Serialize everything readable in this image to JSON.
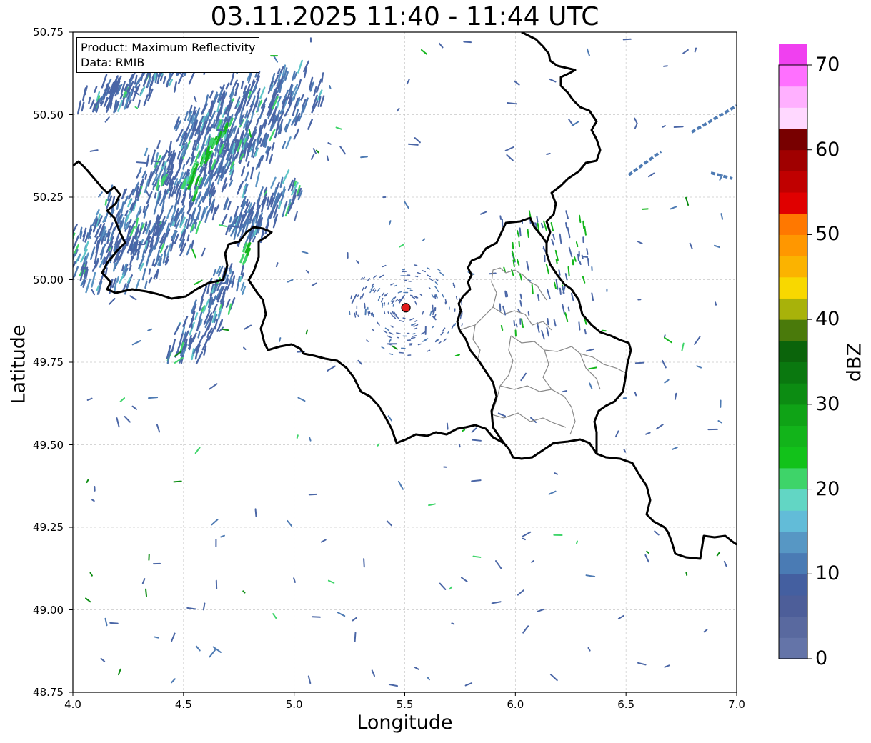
{
  "title": "03.11.2025 11:40 - 11:44 UTC",
  "info_box": {
    "product": "Product: Maximum Reflectivity",
    "data": "Data: RMIB"
  },
  "axes": {
    "xlabel": "Longitude",
    "ylabel": "Latitude",
    "xlim": [
      4.0,
      7.0
    ],
    "ylim": [
      48.75,
      50.75
    ],
    "xticks": [
      "4.0",
      "4.5",
      "5.0",
      "5.5",
      "6.0",
      "6.5",
      "7.0"
    ],
    "yticks": [
      "48.75",
      "49.00",
      "49.25",
      "49.50",
      "49.75",
      "50.00",
      "50.25",
      "50.50",
      "50.75"
    ],
    "grid": true
  },
  "radar_site": {
    "lon": 5.505,
    "lat": 49.915,
    "marker_color": "#e11d1d"
  },
  "colorbar": {
    "label": "dBZ",
    "min": 0,
    "max": 70,
    "step": 2.5,
    "ticks": [
      "0",
      "10",
      "20",
      "30",
      "40",
      "50",
      "60",
      "70"
    ],
    "colors": [
      "#6474a8",
      "#59699f",
      "#4d5e99",
      "#445fa0",
      "#4a7bb4",
      "#5797c4",
      "#62bcd8",
      "#62d6c4",
      "#3ed469",
      "#12c21a",
      "#12b41a",
      "#0fa316",
      "#0c8c12",
      "#0a780f",
      "#0b640b",
      "#4a7a0b",
      "#a8b20a",
      "#f8d800",
      "#fbb300",
      "#ff9700",
      "#ff7800",
      "#e00000",
      "#c00000",
      "#a00000",
      "#780000",
      "#ffd8ff",
      "#ffb0ff",
      "#ff70ff",
      "#f040f0"
    ]
  },
  "boundaries": {
    "national_color": "#000000",
    "regional_color": "#888888"
  },
  "precip_colors": [
    "#4a66a6",
    "#4d7ab3",
    "#5a94c3",
    "#5fc5c8",
    "#3fd56a",
    "#13b51b",
    "#0b8c11"
  ]
}
